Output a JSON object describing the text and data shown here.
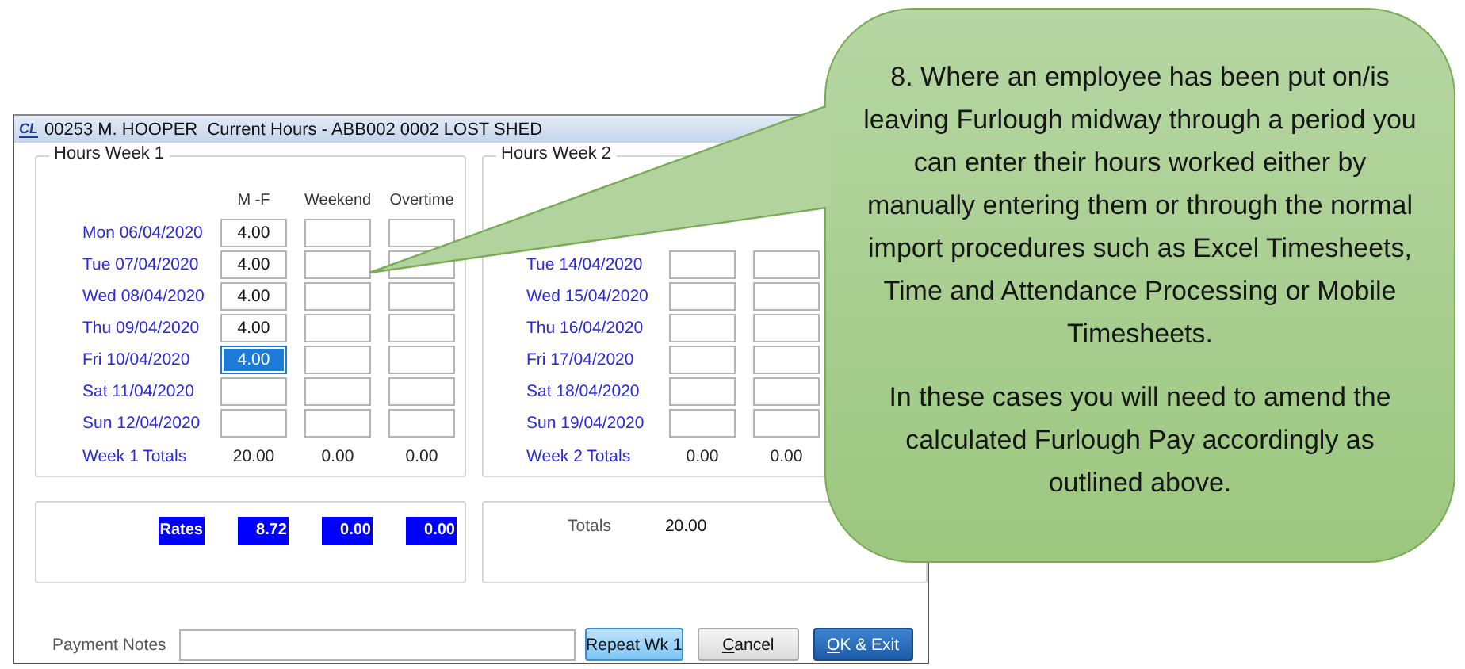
{
  "window": {
    "logo": "CL",
    "title": "00253 M. HOOPER  Current Hours - ABB002 0002 LOST SHED"
  },
  "week_1": {
    "title": "Hours Week 1",
    "headers": [
      "M -F",
      "Weekend",
      "Overtime"
    ],
    "rows": [
      {
        "date": "Mon 06/04/2020",
        "fields": [
          {
            "value": "4.00",
            "focused": false
          },
          {
            "focused": false
          },
          {
            "focused": false
          }
        ]
      },
      {
        "date": "Tue 07/04/2020",
        "fields": [
          {
            "value": "4.00",
            "focused": false
          },
          {
            "focused": false
          },
          {
            "focused": false
          }
        ]
      },
      {
        "date": "Wed 08/04/2020",
        "fields": [
          {
            "value": "4.00",
            "focused": false
          },
          {
            "focused": false
          },
          {
            "focused": false
          }
        ]
      },
      {
        "date": "Thu 09/04/2020",
        "fields": [
          {
            "value": "4.00",
            "focused": false
          },
          {
            "focused": false
          },
          {
            "focused": false
          }
        ]
      },
      {
        "date": "Fri 10/04/2020",
        "fields": [
          {
            "value": "4.00",
            "focused": true
          },
          {
            "focused": false
          },
          {
            "focused": false
          }
        ]
      },
      {
        "date": "Sat 11/04/2020",
        "fields": [
          {
            "focused": false
          },
          {
            "focused": false
          },
          {
            "focused": false
          }
        ]
      },
      {
        "date": "Sun 12/04/2020",
        "fields": [
          {
            "focused": false
          },
          {
            "focused": false
          },
          {
            "focused": false
          }
        ]
      }
    ],
    "totals_label": "Week 1 Totals",
    "totals": [
      "20.00",
      "0.00",
      "0.00"
    ]
  },
  "week_2": {
    "title": "Hours Week 2",
    "rows": [
      {
        "date": "Tue 14/04/2020",
        "fields": [
          {
            "focused": false
          },
          {
            "focused": false
          }
        ]
      },
      {
        "date": "Wed 15/04/2020",
        "fields": [
          {
            "focused": false
          },
          {
            "focused": false
          }
        ]
      },
      {
        "date": "Thu 16/04/2020",
        "fields": [
          {
            "focused": false
          },
          {
            "focused": false
          }
        ]
      },
      {
        "date": "Fri 17/04/2020",
        "fields": [
          {
            "focused": false
          },
          {
            "focused": false
          }
        ]
      },
      {
        "date": "Sat 18/04/2020",
        "fields": [
          {
            "focused": false
          },
          {
            "focused": false
          }
        ]
      },
      {
        "date": "Sun 19/04/2020",
        "fields": [
          {
            "focused": false
          },
          {
            "focused": false
          }
        ]
      }
    ],
    "totals_label": "Week 2 Totals",
    "totals": [
      "0.00",
      "0.00"
    ]
  },
  "rates": {
    "label": "Rates",
    "values": [
      "8.72",
      "0.00",
      "0.00"
    ]
  },
  "totals_panel": {
    "label": "Totals",
    "value": "20.00"
  },
  "payment_notes": {
    "label": "Payment Notes"
  },
  "buttons": [
    {
      "label": "Repeat Wk 1",
      "kind": "highlighted",
      "underline_first": false
    },
    {
      "label": "Cancel",
      "kind": "normal",
      "underline_first": true
    },
    {
      "label": "OK & Exit",
      "kind": "default",
      "underline_first": true
    }
  ],
  "callout": {
    "paragraphs": [
      "8. Where an employee has been put on/is leaving Furlough midway through a period you can enter their hours worked either by manually entering them or through the normal import procedures such as Excel Timesheets, Time and Attendance Processing or Mobile Timesheets.",
      "In these cases you will need to amend the calculated Furlough Pay accordingly as outlined above."
    ]
  }
}
